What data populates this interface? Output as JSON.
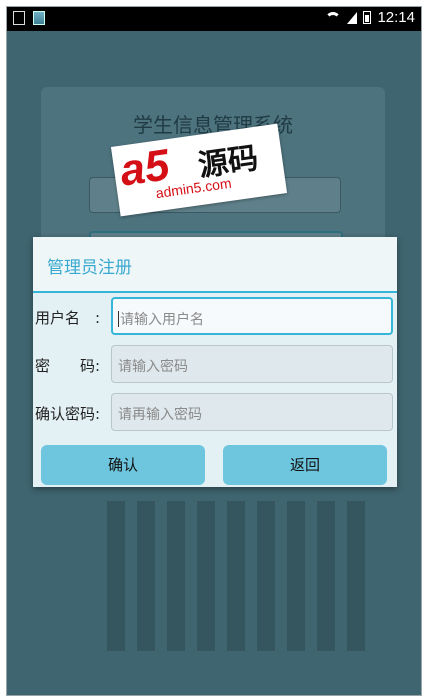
{
  "status_bar": {
    "time": "12:14",
    "icons": [
      "sim-icon",
      "image-icon",
      "wifi-icon",
      "signal-icon",
      "battery-icon"
    ]
  },
  "background": {
    "title": "学生信息管理系统"
  },
  "logo": {
    "mark": "a5",
    "chinese": "源码",
    "url": "admin5.com"
  },
  "dialog": {
    "title": "管理员注册",
    "fields": [
      {
        "label": "用户名　:",
        "placeholder": "请输入用户名"
      },
      {
        "label": "密　　码:",
        "placeholder": "请输入密码"
      },
      {
        "label": "确认密码:",
        "placeholder": "请再输入密码"
      }
    ],
    "confirm_label": "确认",
    "back_label": "返回"
  },
  "colors": {
    "accent": "#35b5d8",
    "button": "#6ec6de",
    "dim_background": "#3f6570"
  }
}
